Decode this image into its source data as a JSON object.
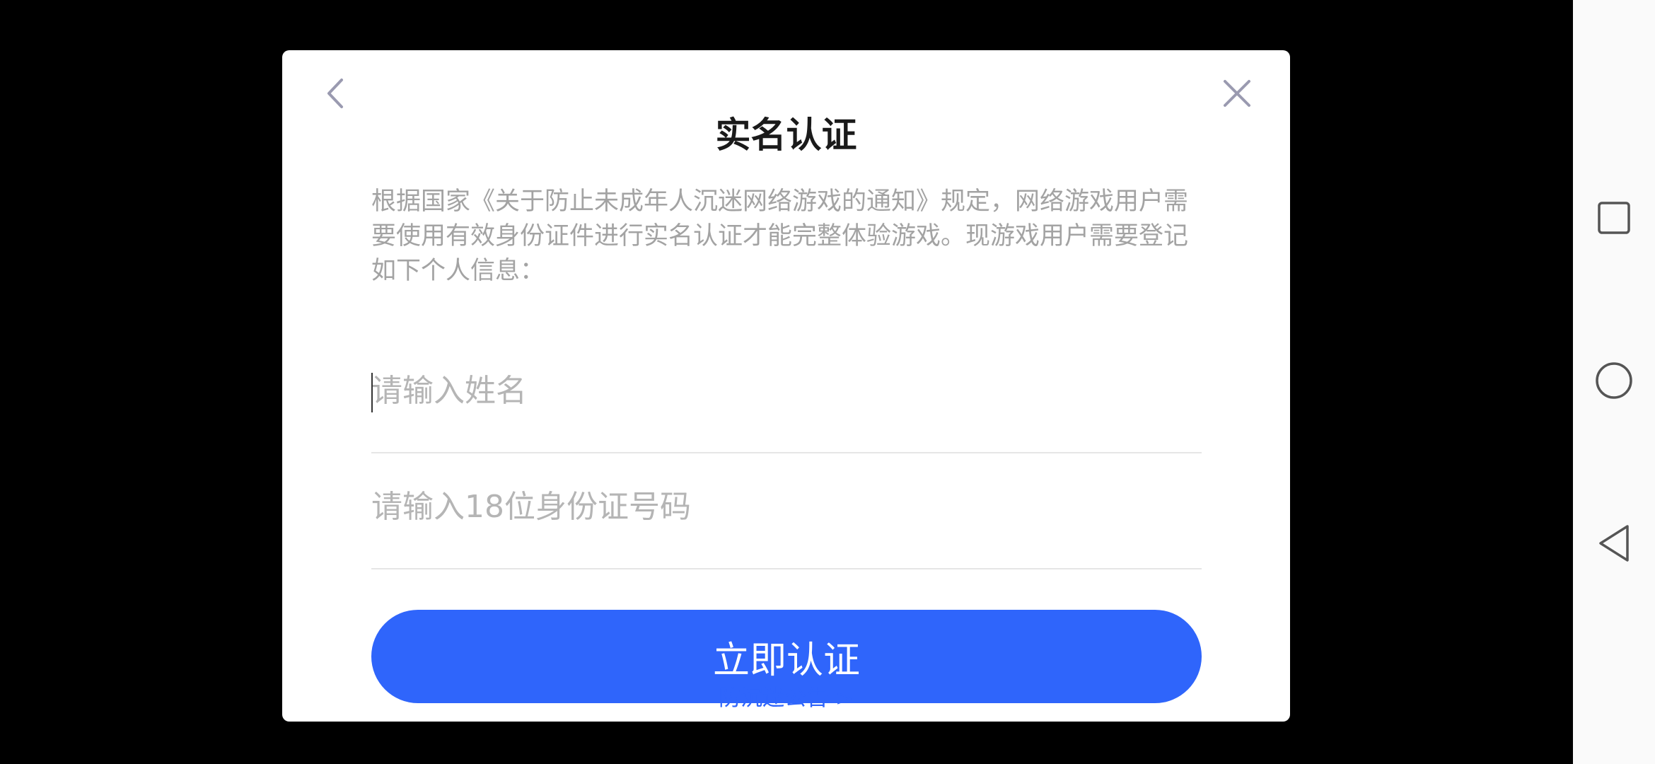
{
  "dialog": {
    "title": "实名认证",
    "notice": "根据国家《关于防止未成年人沉迷网络游戏的通知》规定，网络游戏用户需要使用有效身份证件进行实名认证才能完整体验游戏。现游戏用户需要登记如下个人信息：",
    "name_field": {
      "value": "",
      "placeholder": "请输入姓名"
    },
    "id_field": {
      "value": "",
      "placeholder": "请输入18位身份证号码"
    },
    "submit_label": "立即认证",
    "announcement_link": "防沉迷公告 >",
    "icons": {
      "back": "chevron-left-icon",
      "close": "close-icon"
    }
  },
  "navbar": {
    "icons": [
      "recents-icon",
      "home-icon",
      "back-triangle-icon"
    ]
  },
  "colors": {
    "accent": "#2f65fb",
    "background": "#000000",
    "dialog": "#ffffff",
    "muted_text": "#a3a3a3"
  }
}
